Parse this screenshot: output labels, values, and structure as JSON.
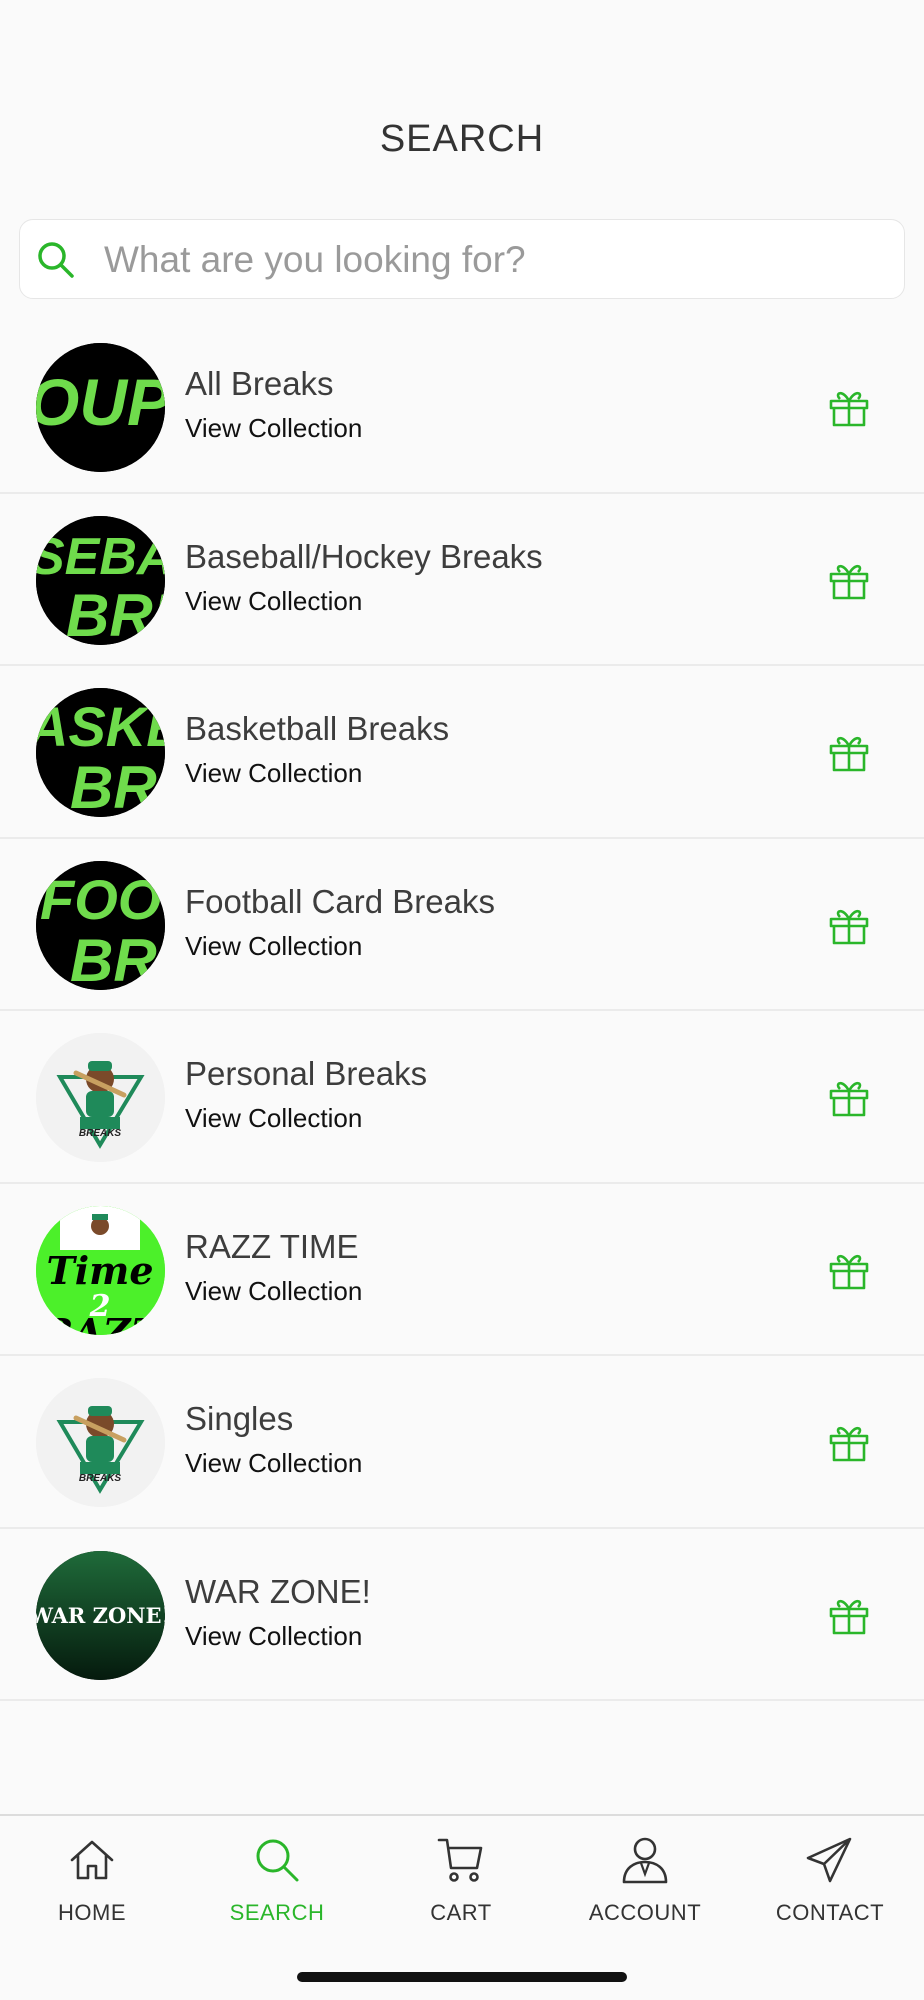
{
  "header": {
    "title": "SEARCH"
  },
  "search": {
    "placeholder": "What are you looking for?",
    "value": ""
  },
  "accent_color": "#2ab62a",
  "collections": [
    {
      "title": "All Breaks",
      "subtitle": "View Collection",
      "thumb_text": "OUP B",
      "icon": "gift-icon"
    },
    {
      "title": "Baseball/Hockey Breaks",
      "subtitle": "View Collection",
      "thumb_text": "SEBALL BRE",
      "icon": "gift-icon"
    },
    {
      "title": "Basketball Breaks",
      "subtitle": "View Collection",
      "thumb_text": "ASKE BRE",
      "icon": "gift-icon"
    },
    {
      "title": "Football Card Breaks",
      "subtitle": "View Collection",
      "thumb_text": "FOOT BRE",
      "icon": "gift-icon"
    },
    {
      "title": "Personal Breaks",
      "subtitle": "View Collection",
      "thumb_text": "BREAKS",
      "icon": "gift-icon"
    },
    {
      "title": "RAZZ TIME",
      "subtitle": "View Collection",
      "thumb_text": "Time 2",
      "icon": "gift-icon"
    },
    {
      "title": "Singles",
      "subtitle": "View Collection",
      "thumb_text": "BREAKS",
      "icon": "gift-icon"
    },
    {
      "title": "WAR ZONE!",
      "subtitle": "View Collection",
      "thumb_text": "WAR ZONE!",
      "icon": "gift-icon"
    }
  ],
  "tabbar": {
    "items": [
      {
        "label": "HOME",
        "icon": "home-icon",
        "active": false
      },
      {
        "label": "SEARCH",
        "icon": "search-icon",
        "active": true
      },
      {
        "label": "CART",
        "icon": "cart-icon",
        "active": false
      },
      {
        "label": "ACCOUNT",
        "icon": "account-icon",
        "active": false
      },
      {
        "label": "CONTACT",
        "icon": "paper-plane-icon",
        "active": false
      }
    ]
  }
}
